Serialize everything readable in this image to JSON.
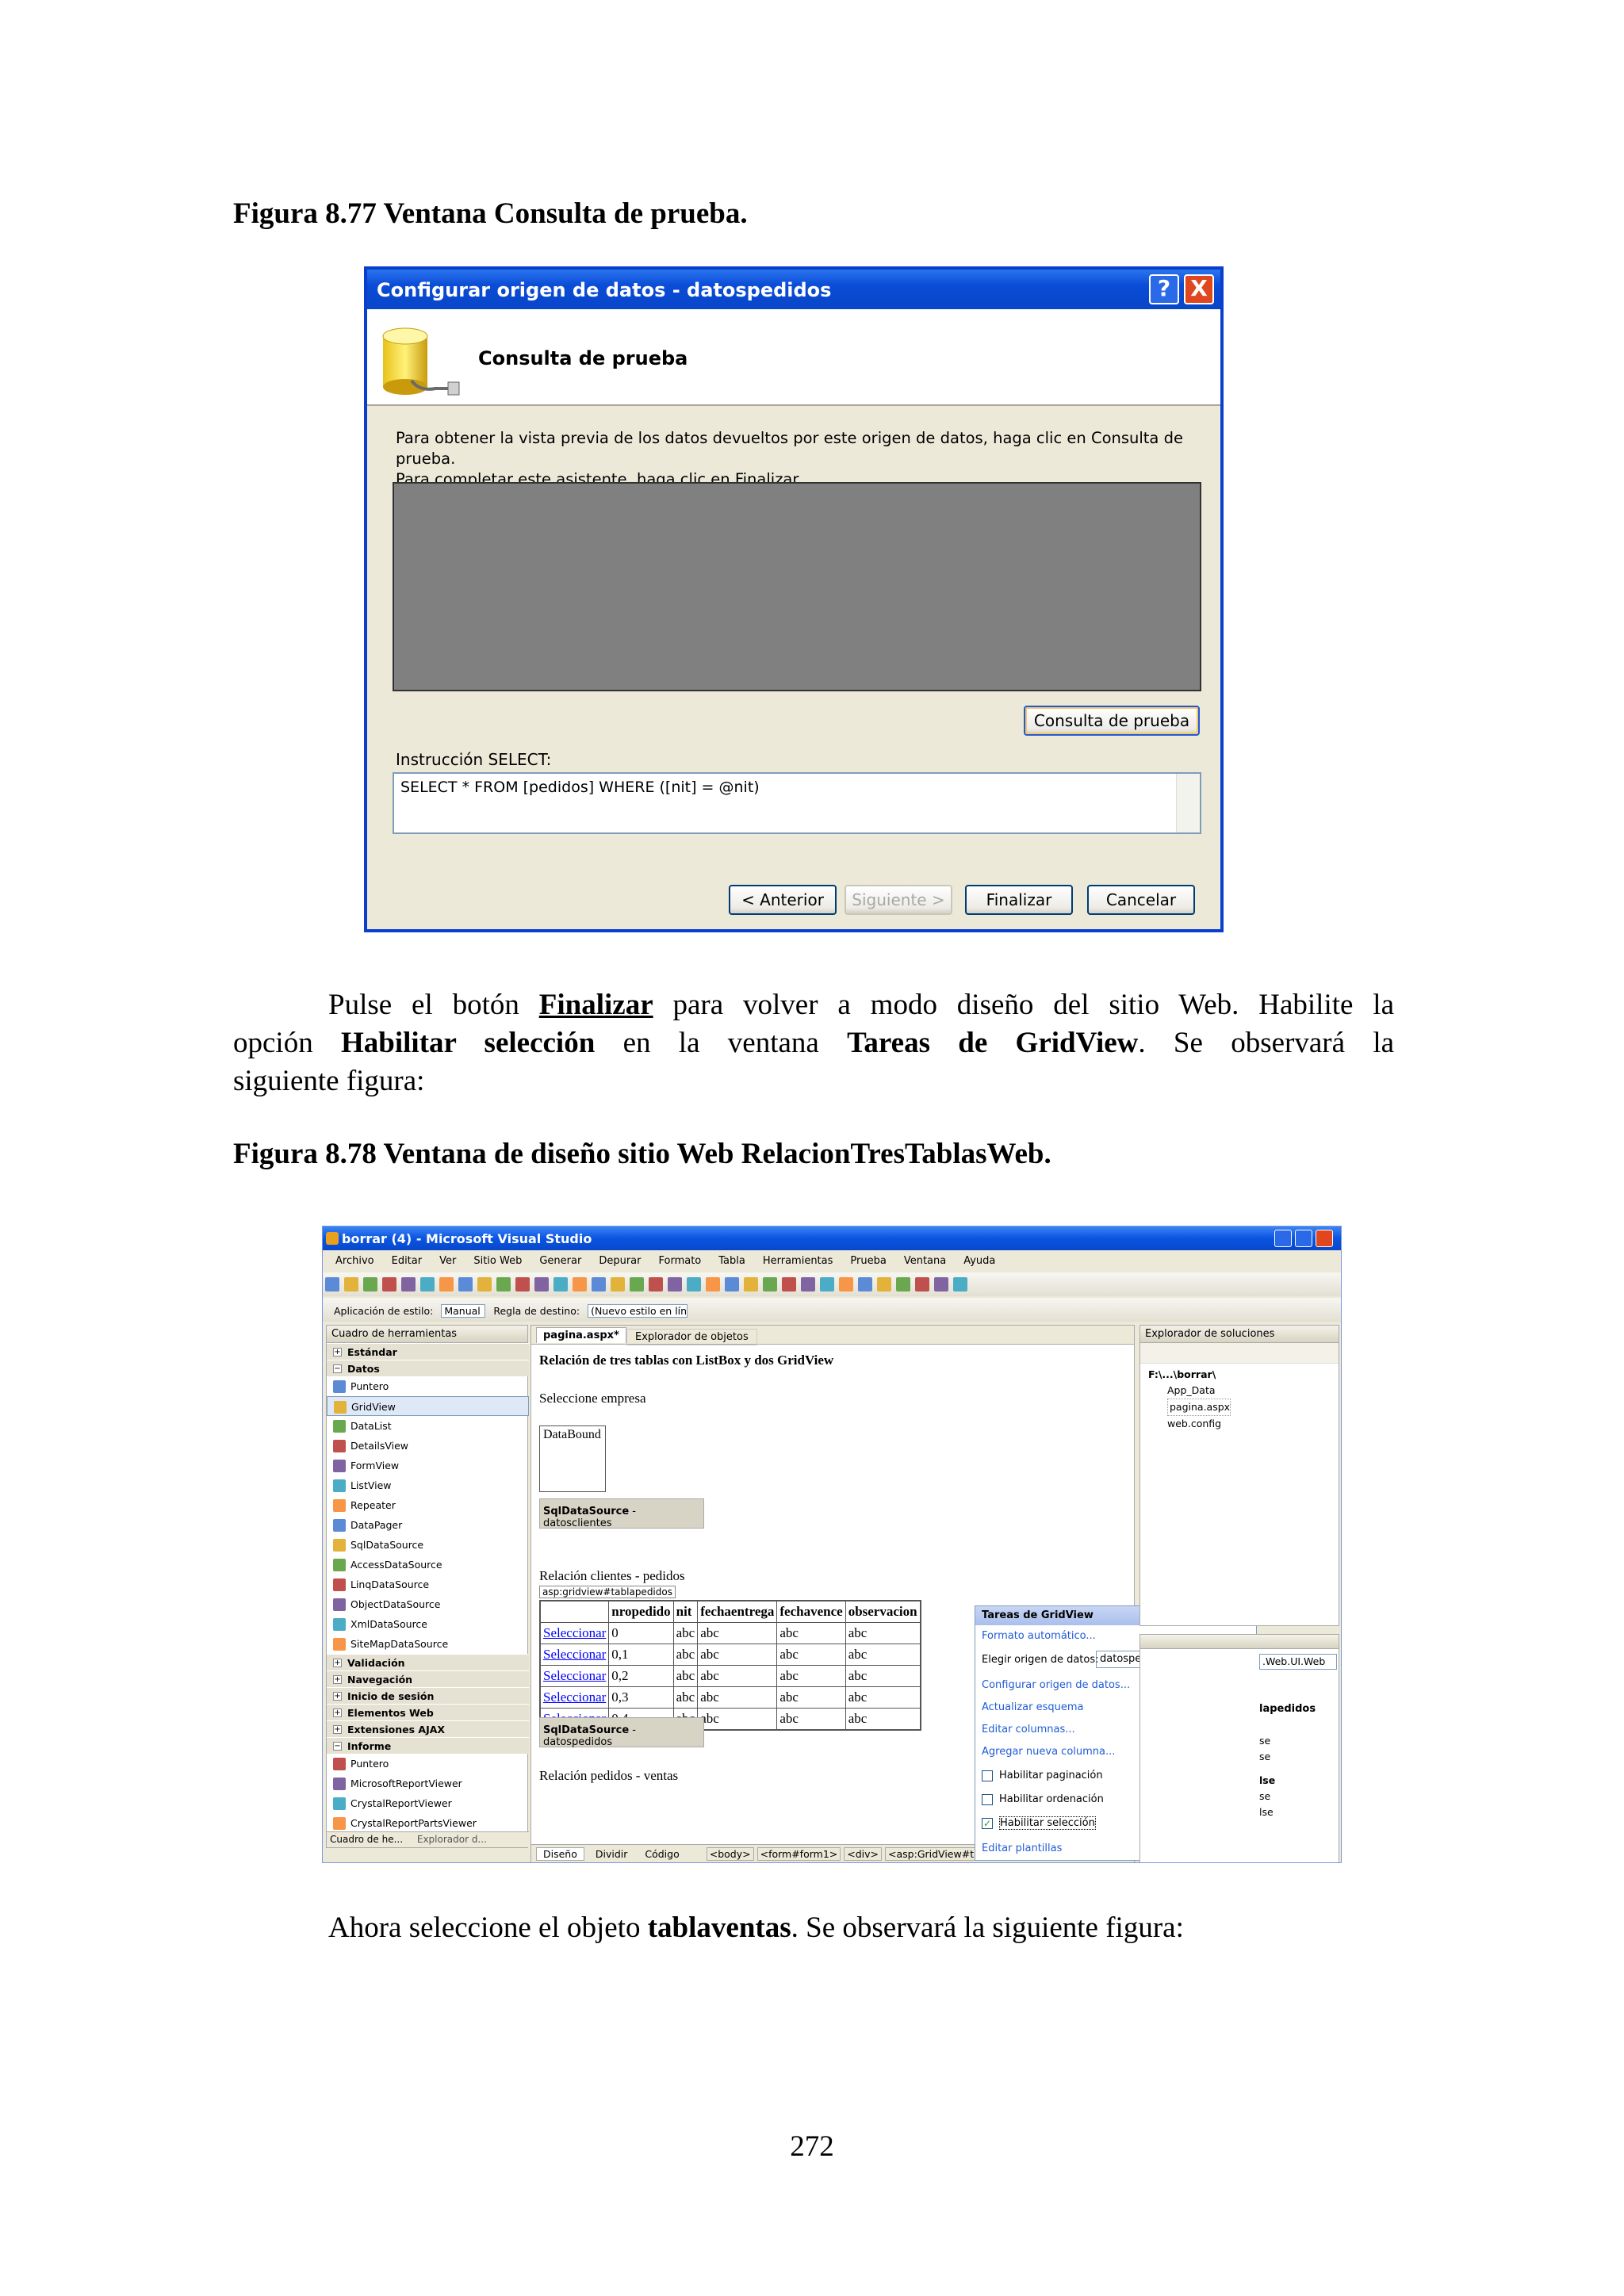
{
  "fig77": {
    "caption": "Figura 8.77 Ventana Consulta de prueba.",
    "title": "Configurar origen de datos - datospedidos",
    "header": "Consulta de prueba",
    "instructions_1": "Para obtener la vista previa de los datos devueltos por este origen de datos, haga clic en Consulta de prueba.",
    "instructions_2": "Para completar este asistente, haga clic en Finalizar.",
    "test_button": "Consulta de prueba",
    "select_label": "Instrucción SELECT:",
    "select_text": "SELECT * FROM [pedidos] WHERE ([nit] = @nit)",
    "buttons": {
      "prev": "< Anterior",
      "next": "Siguiente >",
      "finish": "Finalizar",
      "cancel": "Cancelar"
    },
    "title_help": "?",
    "title_close": "X"
  },
  "paragraph": {
    "p1a": "Pulse el botón ",
    "p1b": "Finalizar",
    "p1c": " para volver a modo diseño del sitio Web. Habilite la",
    "p2a": "opción ",
    "p2b": "Habilitar selección",
    "p2c": " en la ventana ",
    "p2d": "Tareas de GridView",
    "p2e": ". Se observará la",
    "p3": "siguiente figura:"
  },
  "fig78": {
    "caption": "Figura 8.78 Ventana de diseño sitio Web RelacionTresTablasWeb.",
    "title": "borrar (4) - Microsoft Visual Studio",
    "menu": [
      "Archivo",
      "Editar",
      "Ver",
      "Sitio Web",
      "Generar",
      "Depurar",
      "Formato",
      "Tabla",
      "Herramientas",
      "Prueba",
      "Ventana",
      "Ayuda"
    ],
    "style_label": "Aplicación de estilo:",
    "style_value": "Manual",
    "rule_label": "Regla de destino:",
    "rule_value": "(Nuevo estilo en lín",
    "toolbox_title": "Cuadro de herramientas",
    "toolbox": {
      "estandar": "Estándar",
      "datos": "Datos",
      "items1": [
        "Puntero",
        "GridView",
        "DataList",
        "DetailsView",
        "FormView",
        "ListView",
        "Repeater",
        "DataPager",
        "SqlDataSource",
        "AccessDataSource",
        "LinqDataSource",
        "ObjectDataSource",
        "XmlDataSource",
        "SiteMapDataSource"
      ],
      "groups": [
        "Validación",
        "Navegación",
        "Inicio de sesión",
        "Elementos Web",
        "Extensiones AJAX"
      ],
      "informe": "Informe",
      "items2": [
        "Puntero",
        "MicrosoftReportViewer",
        "CrystalReportViewer",
        "CrystalReportPartsViewer"
      ],
      "bottom_tab1": "Cuadro de he...",
      "bottom_tab2": "Explorador d..."
    },
    "tabs": {
      "page": "pagina.aspx*",
      "objects": "Explorador de objetos"
    },
    "design": {
      "heading": "Relación de tres tablas con ListBox y dos GridView",
      "select_company": "Seleccione empresa",
      "listbox": "DataBound",
      "sds1_name": "SqlDataSource",
      "sds1_id": " - datosclientes",
      "rel1": "Relación clientes - pedidos",
      "grid_tag": "asp:gridview#tablapedidos",
      "columns": [
        "nropedido",
        "nit",
        "fechaentrega",
        "fechavence",
        "observacion"
      ],
      "rows": [
        [
          "Seleccionar",
          "0",
          "abc",
          "abc",
          "abc",
          "abc"
        ],
        [
          "Seleccionar",
          "0,1",
          "abc",
          "abc",
          "abc",
          "abc"
        ],
        [
          "Seleccionar",
          "0,2",
          "abc",
          "abc",
          "abc",
          "abc"
        ],
        [
          "Seleccionar",
          "0,3",
          "abc",
          "abc",
          "abc",
          "abc"
        ],
        [
          "Seleccionar",
          "0,4",
          "abc",
          "abc",
          "abc",
          "abc"
        ]
      ],
      "sds2_name": "SqlDataSource",
      "sds2_id": " - datospedidos",
      "rel2": "Relación pedidos - ventas"
    },
    "tasks": {
      "title": "Tareas de GridView",
      "autoformat": "Formato automático...",
      "choose_label": "Elegir origen de datos:",
      "choose_value": "datospedidos",
      "configure": "Configurar origen de datos...",
      "refresh": "Actualizar esquema",
      "edit_cols": "Editar columnas...",
      "add_col": "Agregar nueva columna...",
      "paging": "Habilitar paginación",
      "sorting": "Habilitar ordenación",
      "selection": "Habilitar selección",
      "templates": "Editar plantillas"
    },
    "solution": {
      "title": "Explorador de soluciones",
      "root": "F:\\...\\borrar\\",
      "items": [
        "App_Data",
        "pagina.aspx",
        "web.config"
      ]
    },
    "props_partial": {
      "combo": ".Web.UI.Web",
      "bold1": "lapedidos",
      "t1": "se",
      "t2": "se",
      "bold2": "lse",
      "t3": "se",
      "t4": "lse"
    },
    "bottom": {
      "design": "Diseño",
      "split": "Dividir",
      "code": "Código",
      "crumbs": [
        "<body>",
        "<form#form1>",
        "<div>",
        "<asp:GridView#tablapedidos>"
      ]
    }
  },
  "closing": {
    "a": "Ahora seleccione el objeto ",
    "b": "tablaventas",
    "c": ". Se observará la siguiente figura:"
  },
  "page_number": "272"
}
